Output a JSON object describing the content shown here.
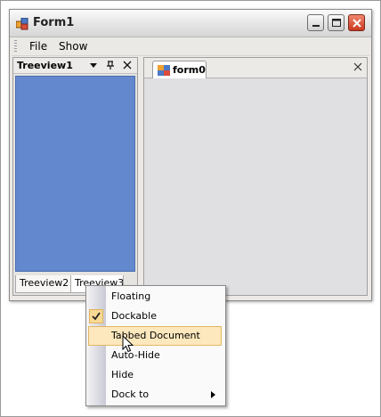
{
  "window": {
    "title": "Form1"
  },
  "menu": {
    "items": [
      "File",
      "Show"
    ]
  },
  "dock_panel": {
    "title": "Treeview1",
    "bottom_tabs": [
      "Treeview2",
      "Treeview3"
    ]
  },
  "document": {
    "tab_label": "form0"
  },
  "context_menu": {
    "items": [
      {
        "label": "Floating",
        "checked": false
      },
      {
        "label": "Dockable",
        "checked": true
      },
      {
        "label": "Tabbed Document",
        "checked": false,
        "highlighted": true
      },
      {
        "label": "Auto-Hide",
        "checked": false
      },
      {
        "label": "Hide",
        "checked": false
      },
      {
        "label": "Dock to",
        "checked": false,
        "submenu": true
      }
    ]
  },
  "colors": {
    "tree_background": "#6388cd",
    "highlight": "#fde8bd"
  }
}
